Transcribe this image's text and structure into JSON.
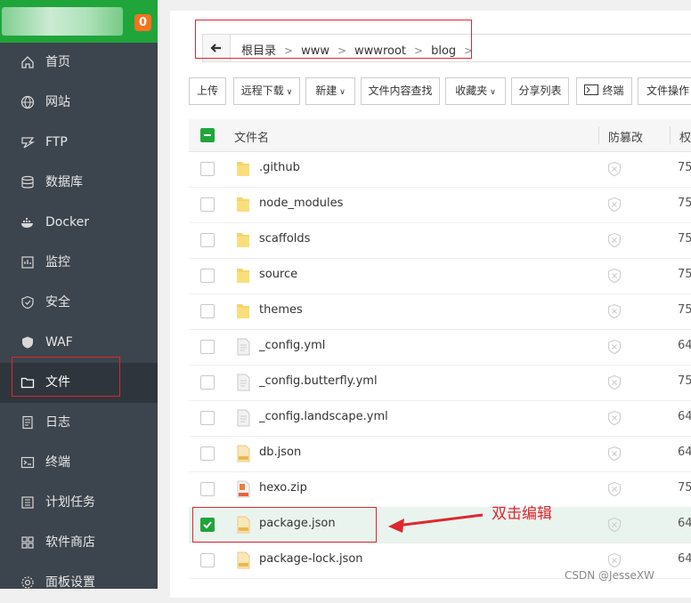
{
  "sidebar": {
    "badge": "0",
    "items": [
      {
        "label": "首页",
        "icon": "home-icon"
      },
      {
        "label": "网站",
        "icon": "globe-icon"
      },
      {
        "label": "FTP",
        "icon": "ftp-icon"
      },
      {
        "label": "数据库",
        "icon": "database-icon"
      },
      {
        "label": "Docker",
        "icon": "docker-icon"
      },
      {
        "label": "监控",
        "icon": "monitor-icon"
      },
      {
        "label": "安全",
        "icon": "shield-icon"
      },
      {
        "label": "WAF",
        "icon": "waf-icon"
      },
      {
        "label": "文件",
        "icon": "folder-icon"
      },
      {
        "label": "日志",
        "icon": "log-icon"
      },
      {
        "label": "终端",
        "icon": "terminal-icon"
      },
      {
        "label": "计划任务",
        "icon": "task-icon"
      },
      {
        "label": "软件商店",
        "icon": "grid-icon"
      },
      {
        "label": "面板设置",
        "icon": "settings-icon"
      }
    ],
    "active_index": 8
  },
  "breadcrumb": [
    "根目录",
    "www",
    "wwwroot",
    "blog"
  ],
  "toolbar": {
    "upload": "上传",
    "remote_download": "远程下载",
    "new": "新建",
    "content_search": "文件内容查找",
    "favorites": "收藏夹",
    "share_list": "分享列表",
    "terminal": "终端",
    "file_ops": "文件操作"
  },
  "table": {
    "col_name": "文件名",
    "col_protect": "防篡改",
    "col_perm": "权",
    "rows": [
      {
        "name": ".github",
        "type": "folder",
        "perm": "75",
        "checked": false
      },
      {
        "name": "node_modules",
        "type": "folder",
        "perm": "75",
        "checked": false
      },
      {
        "name": "scaffolds",
        "type": "folder",
        "perm": "75",
        "checked": false
      },
      {
        "name": "source",
        "type": "folder",
        "perm": "75",
        "checked": false
      },
      {
        "name": "themes",
        "type": "folder",
        "perm": "75",
        "checked": false
      },
      {
        "name": "_config.yml",
        "type": "file",
        "perm": "64",
        "checked": false
      },
      {
        "name": "_config.butterfly.yml",
        "type": "file",
        "perm": "75",
        "checked": false
      },
      {
        "name": "_config.landscape.yml",
        "type": "file",
        "perm": "64",
        "checked": false
      },
      {
        "name": "db.json",
        "type": "json",
        "perm": "64",
        "checked": false
      },
      {
        "name": "hexo.zip",
        "type": "zip",
        "perm": "75",
        "checked": false
      },
      {
        "name": "package.json",
        "type": "json",
        "perm": "64",
        "checked": true
      },
      {
        "name": "package-lock.json",
        "type": "json",
        "perm": "64",
        "checked": false
      }
    ]
  },
  "annotation": "双击编辑",
  "watermark": "CSDN @JesseXW",
  "colors": {
    "accent": "#20a53a",
    "annotation_red": "#e0262f",
    "sidebar_bg": "#3c444d"
  }
}
